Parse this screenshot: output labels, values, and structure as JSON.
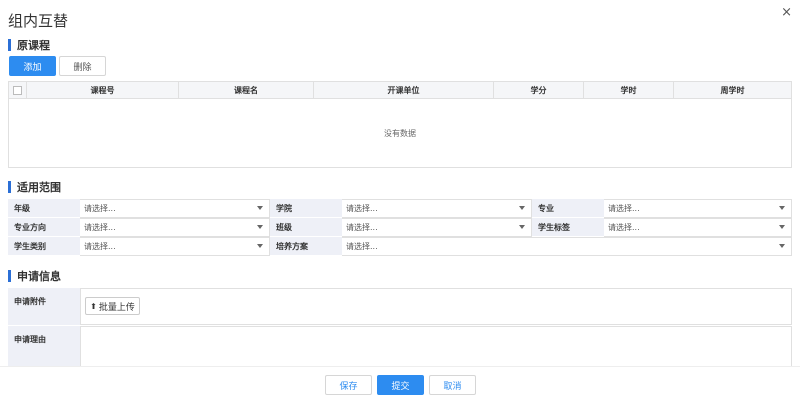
{
  "dialog": {
    "title": "组内互替",
    "close_icon": "×"
  },
  "original_course": {
    "heading": "原课程",
    "add_label": "添加",
    "delete_label": "删除",
    "columns": [
      "课程号",
      "课程名",
      "开课单位",
      "学分",
      "学时",
      "周学时"
    ],
    "empty_text": "没有数据"
  },
  "scope": {
    "heading": "适用范围",
    "rows": [
      [
        {
          "label": "年级",
          "value": "请选择..."
        },
        {
          "label": "学院",
          "value": "请选择..."
        },
        {
          "label": "专业",
          "value": "请选择..."
        }
      ],
      [
        {
          "label": "专业方向",
          "value": "请选择..."
        },
        {
          "label": "班级",
          "value": "请选择..."
        },
        {
          "label": "学生标签",
          "value": "请选择..."
        }
      ]
    ],
    "row3": [
      {
        "label": "学生类别",
        "value": "请选择..."
      },
      {
        "label": "培养方案",
        "value": "请选择..."
      }
    ]
  },
  "apply": {
    "heading": "申请信息",
    "attachment_label": "申请附件",
    "upload_label": "批量上传",
    "reason_label": "申请理由"
  },
  "footer": {
    "save_label": "保存",
    "submit_label": "提交",
    "cancel_label": "取消"
  },
  "colors": {
    "primary": "#2d8cf0",
    "accent_bar": "#2b6fd6",
    "label_bg": "#eef0f7"
  }
}
